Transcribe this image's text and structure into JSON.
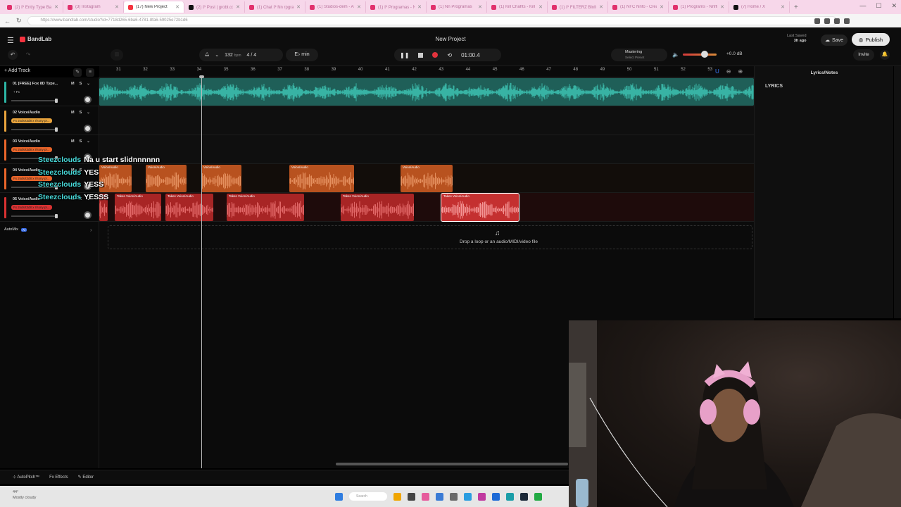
{
  "browser": {
    "tabs": [
      {
        "label": "(2) ℙ Entty Type Ba"
      },
      {
        "label": "(3) Instagram"
      },
      {
        "label": "(17) New Project"
      },
      {
        "label": "(2) ℙ Post | grobt.com"
      },
      {
        "label": "(1) Chat ℙ Nn rpgrams"
      },
      {
        "label": "(1) Studios-dem - Ans"
      },
      {
        "label": "(1) ℙ Programas - Nnfo"
      },
      {
        "label": "(1) Nn Programas"
      },
      {
        "label": "(1) Kill Chahts - Kill"
      },
      {
        "label": "(1) ℙ FILTERZ Blnfo"
      },
      {
        "label": "(1) NFC Nnfo - Creat"
      },
      {
        "label": "(1) Programs - Nnffn"
      },
      {
        "label": "(7) Home / X"
      }
    ],
    "active_tab": 2,
    "url": "https://www.bandlab.com/studio?id=7718d265-6ba6-4781-8fa6-59025e72b1d6",
    "window_controls": [
      "—",
      "☐",
      "✕"
    ],
    "new_tab": "+"
  },
  "app": {
    "logo": "BandLab",
    "project_title": "New Project",
    "last_saved_label": "Last Saved",
    "last_saved_value": "3h ago",
    "save_label": "Save",
    "publish_label": "Publish",
    "invite_label": "Invite",
    "bpm_value": "132",
    "bpm_unit": "bpm",
    "time_signature": "4 / 4",
    "key_label": "E♭ min",
    "time_display": "01:00.4",
    "mastering_label": "Mastering",
    "mastering_preset": "Select Preset",
    "master_volume_db": "+0.0 dB",
    "add_track_label": "Add Track",
    "automix_label": "AutoMix",
    "automix_badge": "AI",
    "drop_text": "Drop a loop or an audio/MIDI/video file",
    "lyrics_panel_title": "Lyrics/Notes",
    "lyrics_label": "LYRICS",
    "accent_color": "#f5333f",
    "icons": [
      "menu-icon",
      "undo-icon",
      "redo-icon",
      "metronome-icon",
      "pause-icon",
      "stop-icon",
      "record-icon",
      "loop-icon",
      "speaker-icon",
      "bell-icon",
      "globe-icon",
      "cloud-icon",
      "magnet-icon",
      "zoom-out-icon",
      "zoom-in-icon"
    ]
  },
  "ruler": {
    "bars": [
      "31",
      "32",
      "33",
      "34",
      "35",
      "36",
      "37",
      "38",
      "39",
      "40",
      "41",
      "42",
      "43",
      "44",
      "45",
      "46",
      "47",
      "48",
      "49",
      "50",
      "51",
      "52",
      "53"
    ]
  },
  "tracks": [
    {
      "number": "01",
      "name": "[FREE] Fox 8D Type...",
      "fx": "+ Fx",
      "color": "#2cb5a5",
      "mute": "M",
      "solo": "S"
    },
    {
      "number": "02",
      "name": "Voice/Audio",
      "fx": "Fx 2sdsrt3d8 x Il tony pr...",
      "color": "#e8a33c",
      "mute": "M",
      "solo": "S"
    },
    {
      "number": "03",
      "name": "Voice/Audio",
      "fx": "Fx 2sdsrt3d8 x Il tony pr...",
      "color": "#e9652a",
      "mute": "M",
      "solo": "S"
    },
    {
      "number": "04",
      "name": "Voice/Audio",
      "fx": "Fx 2sdsrt3d8 x Il tony pr...",
      "color": "#e9652a",
      "mute": "M",
      "solo": "S"
    },
    {
      "number": "05",
      "name": "Voice/Audio",
      "fx": "Fx 2sdsrt3d8 x Il tony pr...",
      "color": "#d93232",
      "mute": "M",
      "solo": "S"
    }
  ],
  "clips": {
    "voice_label": "Voice/Audio",
    "take_label": "Takes",
    "track5_labels": [
      "Takes  Voice/Au...",
      "Takes  Voice/Audio",
      "Takes  Voice/Audio",
      "Takes  Voice/Audio",
      "Takes  Voice/Audio"
    ]
  },
  "chat": [
    {
      "user": "Steezclouds",
      "message": "Na u start slidnnnnnn"
    },
    {
      "user": "Steezclouds",
      "message": "YES"
    },
    {
      "user": "Steezclouds",
      "message": "YESS"
    },
    {
      "user": "Steezclouds",
      "message": "YESSS"
    }
  ],
  "footer": {
    "autopitch": "AutoPitch™",
    "effects": "Effects",
    "editor": "Editor"
  },
  "taskbar": {
    "weather_temp": "44°",
    "weather_desc": "Mostly cloudy",
    "search_placeholder": "Search"
  }
}
